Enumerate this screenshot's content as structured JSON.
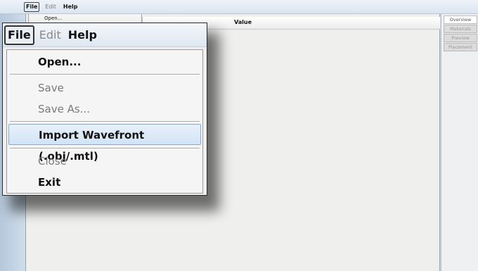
{
  "background_window": {
    "menubar": {
      "file": "File",
      "edit": "Edit",
      "help": "Help"
    },
    "peek_item": "Open...",
    "table": {
      "value_header": "Value"
    },
    "right_tabs": [
      "Overview",
      "Materials",
      "Preview",
      "Placement"
    ]
  },
  "callout": {
    "menubar": {
      "file": "File",
      "edit": "Edit",
      "help": "Help"
    },
    "menu": {
      "open": "Open...",
      "save": "Save",
      "save_as": "Save As...",
      "import": "Import Wavefront (.obj/.mtl)",
      "close": "Close",
      "exit": "Exit"
    }
  }
}
